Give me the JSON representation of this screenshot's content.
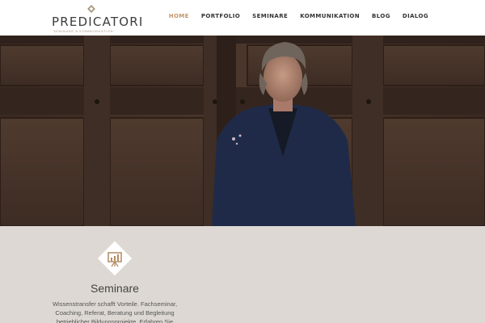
{
  "header": {
    "logo_text": "PREDICATORI",
    "logo_subtitle": "SEMINARE & KOMMUNIKATION"
  },
  "nav": {
    "items": [
      {
        "label": "HOME",
        "active": true
      },
      {
        "label": "PORTFOLIO",
        "active": false
      },
      {
        "label": "SEMINARE",
        "active": false
      },
      {
        "label": "KOMMUNIKATION",
        "active": false
      },
      {
        "label": "BLOG",
        "active": false
      },
      {
        "label": "DIALOG",
        "active": false
      }
    ]
  },
  "colors": {
    "accent": "#c4966a",
    "feature_bg": "#ddd8d3",
    "wood_dark": "#3b2a22"
  },
  "feature": {
    "icon": "presentation-board-icon",
    "title": "Seminare",
    "text": "Wissenstransfer schafft Vorteile. Fachseminar, Coaching, Referat, Beratung und Begleitung betrieblicher Bildungsprojekte. Erfahren Sie"
  }
}
